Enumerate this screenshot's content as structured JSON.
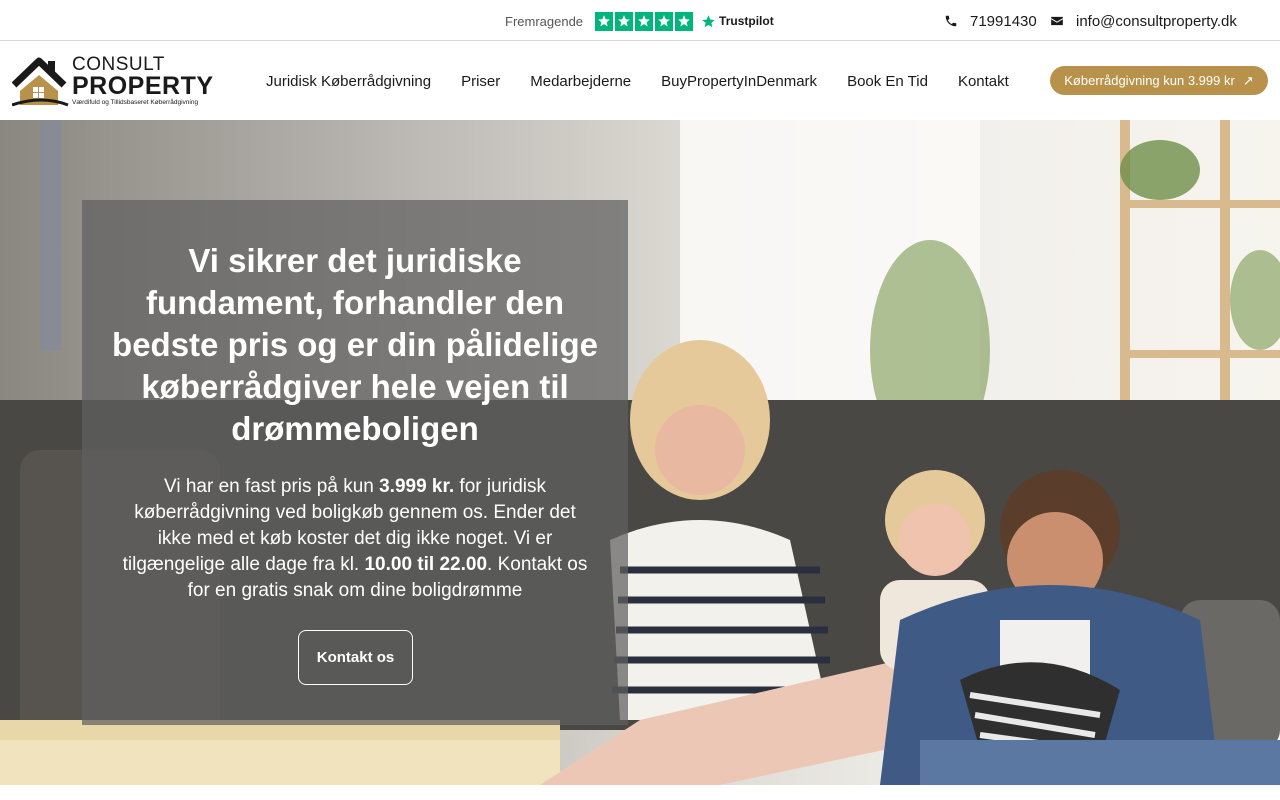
{
  "topbar": {
    "trustpilot_label": "Fremragende",
    "trustpilot_stars": 5,
    "trustpilot_brand": "Trustpilot",
    "phone": "71991430",
    "email": "info@consultproperty.dk"
  },
  "header": {
    "logo": {
      "line1": "CONSULT",
      "line2": "PROPERTY",
      "tagline": "Værdifuld og Tillidsbaseret Køberrådgivning"
    },
    "nav": [
      {
        "label": "Juridisk Køberrådgivning"
      },
      {
        "label": "Priser"
      },
      {
        "label": "Medarbejderne"
      },
      {
        "label": "BuyPropertyInDenmark"
      },
      {
        "label": "Book En Tid"
      },
      {
        "label": "Kontakt"
      }
    ],
    "cta_label": "Køberrådgivning kun 3.999 kr",
    "cta_icon": "arrow-up-right-icon"
  },
  "hero": {
    "title": "Vi sikrer det juridiske fundament, forhandler den bedste pris og er din pålidelige køberrådgiver hele vejen til drømmeboligen",
    "text_1": "Vi har en fast pris på kun ",
    "text_price": "3.999 kr.",
    "text_2": " for juridisk køberrådgivning ved boligkøb gennem os. Ender det ikke med et køb koster det dig ikke noget. Vi er tilgængelige alle dage fra kl. ",
    "text_hours": "10.00 til 22.00",
    "text_3": ". Kontakt os for en gratis snak om dine boligdrømme",
    "button_label": "Kontakt os"
  },
  "colors": {
    "accent": "#b8924a",
    "trustpilot_green": "#00b67a",
    "overlay": "#5f5f5f"
  }
}
